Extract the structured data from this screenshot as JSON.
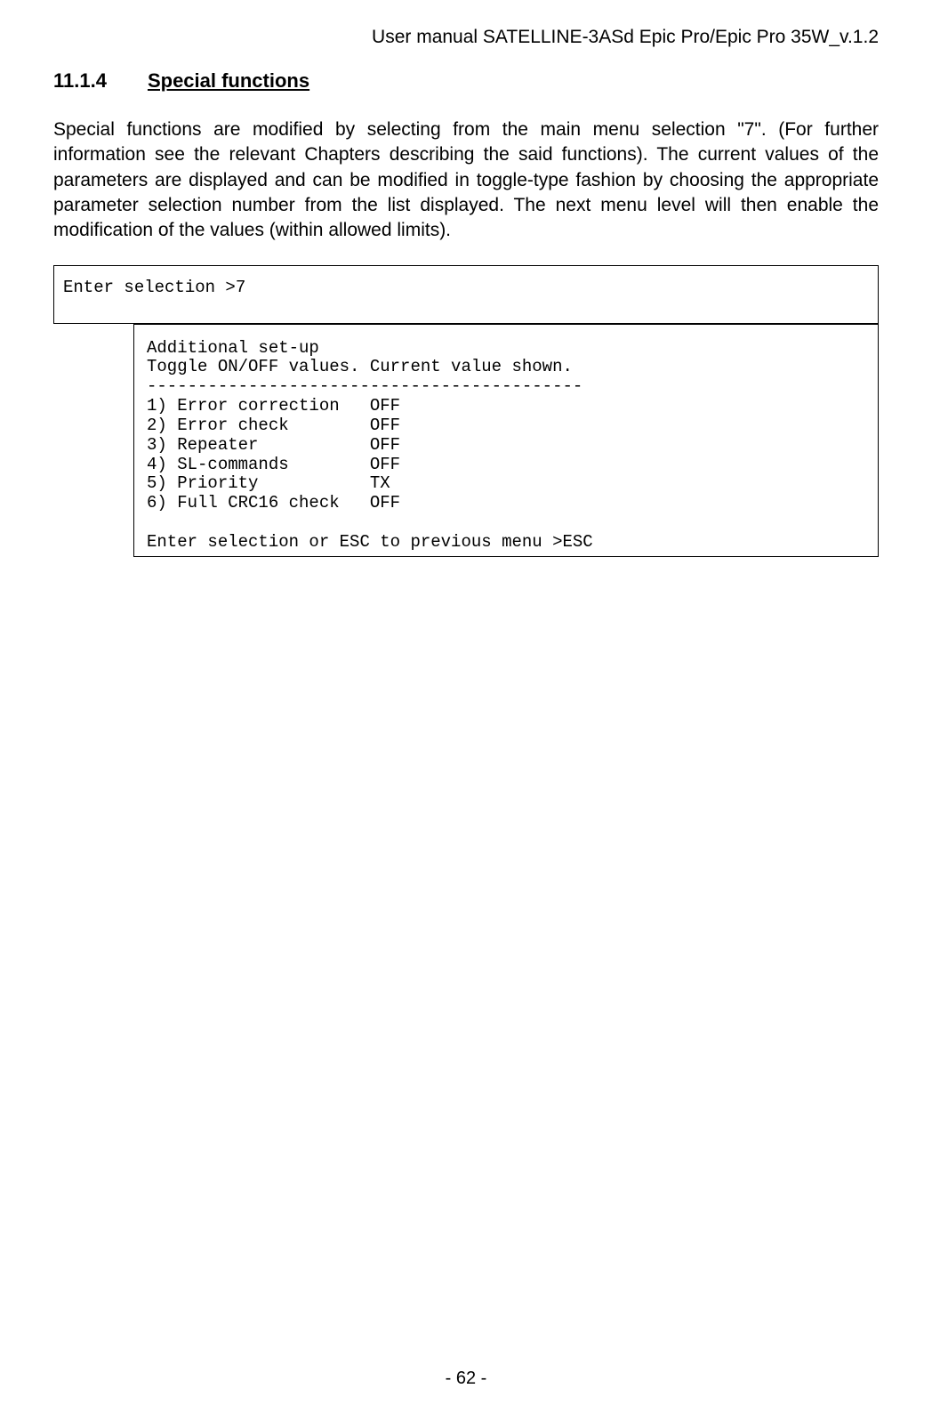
{
  "header": {
    "running_title": "User manual SATELLINE-3ASd Epic Pro/Epic Pro 35W_v.1.2"
  },
  "section": {
    "number": "11.1.4",
    "title": "Special functions"
  },
  "paragraph": "Special functions are modified by selecting from the main menu selection \"7\". (For further information see the relevant Chapters describing the said functions). The current values of the parameters are displayed and can be modified in toggle-type fashion by choosing the appropriate parameter selection number from the list displayed. The next menu level will then enable the modification of the values (within allowed limits).",
  "terminal": {
    "outer_prompt": "Enter selection >7",
    "inner": {
      "title": "Additional set-up",
      "subtitle": "Toggle ON/OFF values. Current value shown.",
      "divider": "-------------------------------------------",
      "items": [
        {
          "line": "1) Error correction   OFF"
        },
        {
          "line": "2) Error check        OFF"
        },
        {
          "line": "3) Repeater           OFF"
        },
        {
          "line": "4) SL-commands        OFF"
        },
        {
          "line": "5) Priority           TX"
        },
        {
          "line": "6) Full CRC16 check   OFF"
        }
      ],
      "footer_prompt": "Enter selection or ESC to previous menu >ESC"
    }
  },
  "page_footer": "- 62 -"
}
